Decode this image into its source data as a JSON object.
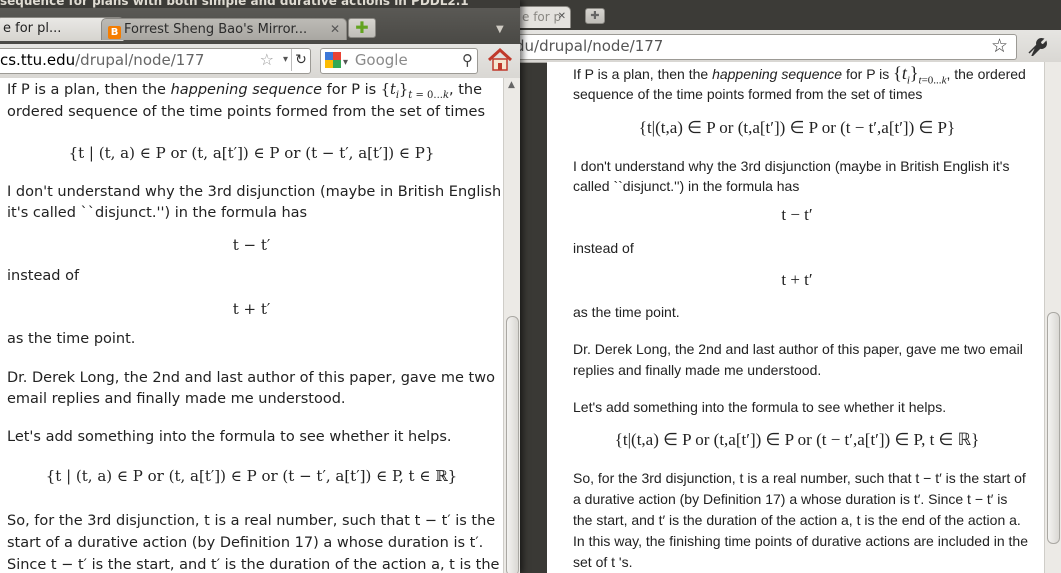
{
  "front_window": {
    "title": "sequence for plans with both simple and durative actions in PDDL2.1",
    "tabs": [
      {
        "label": "e for pl...",
        "close": "✕"
      },
      {
        "label": "Forrest Sheng Bao's Mirror...",
        "close": "✕"
      }
    ],
    "new_tab": "✚",
    "url_host": "cs.ttu.edu",
    "url_path": "/drupal/node/177",
    "search_placeholder": "Google",
    "content": {
      "p1": "If P is a plan, then the happening sequence for P is {t_i}_{t=0...k}, the",
      "p1b": "ordered sequence of the time points formed from the set of times",
      "m1": "{t | (t, a) ∈ P or (t, a[t′]) ∈ P or (t − t′, a[t′]) ∈ P}",
      "p2": "I don't understand why the 3rd disjunction (maybe in British English",
      "p2b": "it's called ``disjunct.'') in the formula has",
      "m2": "t − t′",
      "p3": "instead of",
      "m3": "t + t′",
      "p4": "as the time point.",
      "p5": "Dr. Derek Long, the 2nd and last author of this paper, gave me two",
      "p5b": "email replies and finally made me understood.",
      "p6": "Let's add something into the formula to see whether it helps.",
      "m4": "{t | (t, a) ∈ P or (t, a[t′]) ∈ P or (t − t′, a[t′]) ∈ P, t ∈ ℝ}",
      "p7": "So, for the 3rd disjunction, t is a real number, such that t − t′ is the",
      "p7b": "start of a durative action (by Definition 17) a whose duration is t′.",
      "p7c": "Since t − t′ is the start, and t′ is the duration of the action a, t is the"
    }
  },
  "back_window": {
    "tab": {
      "label": "e for p",
      "close": "✕"
    },
    "new_tab": "✚",
    "url": "du/drupal/node/177",
    "content": {
      "p1": "If P is a plan, then the happening sequence for P is {t_i}_{t=0...k}, the ordered",
      "p1b": "sequence of the time points formed from the set of times",
      "m1": "{t|(t,a) ∈ P or (t,a[t′]) ∈ P or (t − t′,a[t′]) ∈ P}",
      "p2": "I don't understand why the 3rd disjunction (maybe in British English it's",
      "p2b": "called ``disjunct.'') in the formula has",
      "m2": "t − t′",
      "p3": "instead of",
      "m3": "t + t′",
      "p4": "as the time point.",
      "p5": "Dr. Derek Long, the 2nd and last author of this paper, gave me two email",
      "p5b": "replies and finally made me understood.",
      "p6": "Let's add something into the formula to see whether it helps.",
      "m4": "{t|(t,a) ∈ P or (t,a[t′]) ∈ P or (t − t′,a[t′]) ∈ P, t ∈ ℝ}",
      "p7": "So, for the 3rd disjunction, t is a real number, such that t − t′ is the start of",
      "p7b": "a durative action (by Definition 17) a whose duration is t′. Since t − t′ is",
      "p7c": "the start, and t′ is the duration of the action a, t is the end of the action a.",
      "p7d": "In this way, the finishing time points of durative actions are included in the",
      "p7e": "set of t 's."
    }
  }
}
